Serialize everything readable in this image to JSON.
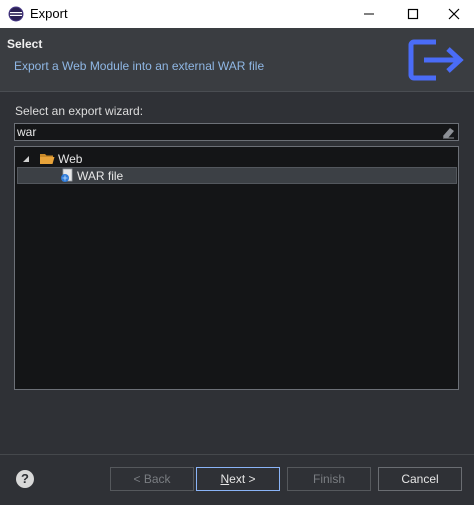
{
  "window": {
    "title": "Export",
    "icon": "eclipse-icon",
    "controls": [
      "minimize-icon",
      "maximize-icon",
      "close-icon"
    ]
  },
  "header": {
    "title": "Select",
    "subtitle": "Export a Web Module into an external WAR file",
    "icon": "export-icon",
    "icon_color": "#4a6cf7"
  },
  "content": {
    "wizard_label": "Select an export wizard:",
    "filter": {
      "value": "war",
      "clear_icon": "eraser-icon"
    },
    "tree": [
      {
        "label": "Web",
        "icon": "folder-open-icon",
        "expanded": true,
        "children": [
          {
            "label": "WAR file",
            "icon": "war-file-icon",
            "selected": true
          }
        ]
      }
    ]
  },
  "buttons": {
    "help": "?",
    "back": "< Back",
    "next_mnemonic": "N",
    "next_rest": "ext >",
    "finish": "Finish",
    "cancel": "Cancel"
  },
  "colors": {
    "accent": "#4a6cf7",
    "focus_border": "#8ab4f8",
    "folder": "#e8a33a"
  }
}
